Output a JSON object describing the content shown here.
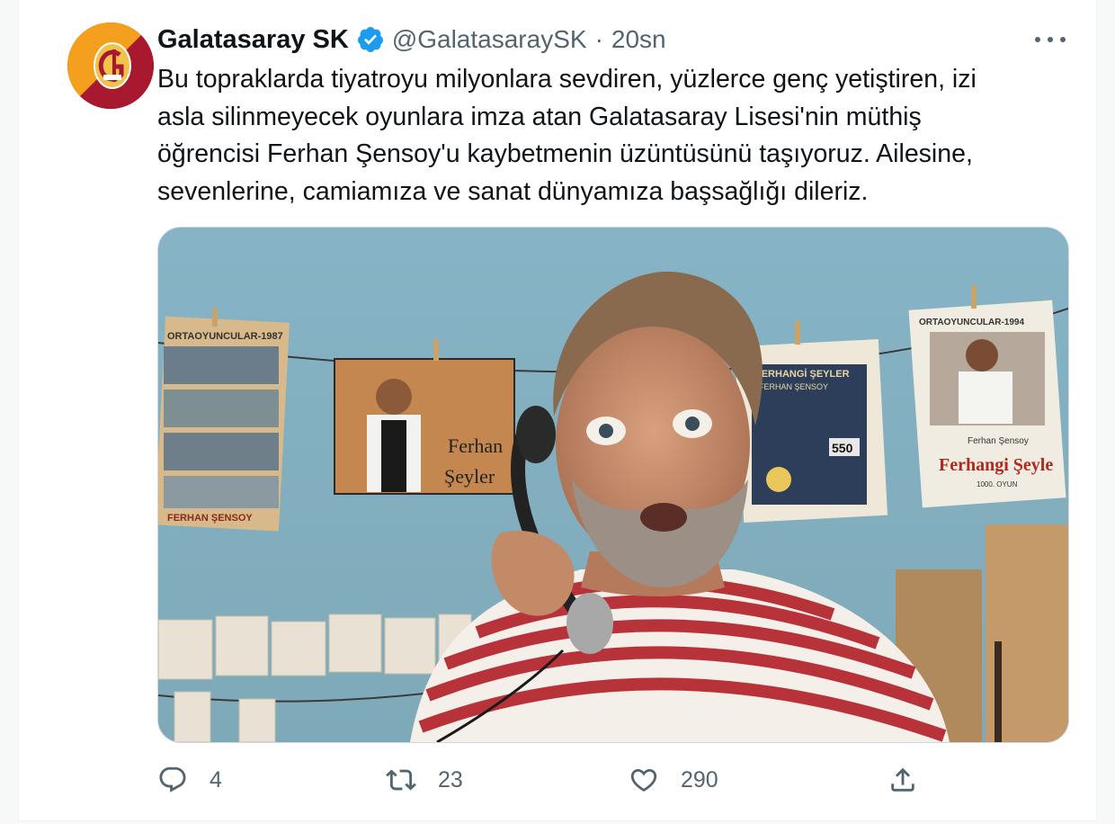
{
  "tweet": {
    "author_name": "Galatasaray SK",
    "author_handle": "@GalatasaraySK",
    "separator": "·",
    "timestamp": "20sn",
    "verified": true,
    "text_lines": [
      "Bu topraklarda tiyatroyu milyonlara sevdiren, yüzlerce genç yetiştiren, izi",
      "asla silinmeyecek oyunlara imza atan Galatasaray Lisesi'nin müthiş",
      "öğrencisi Ferhan Şensoy'u kaybetmenin üzüntüsünü taşıyoruz. Ailesine,",
      "sevenlerine, camiamıza ve sanat dünyamıza başsağlığı dileriz."
    ],
    "media": {
      "poster_left_caption": "ORTAOYUNCULAR-1987",
      "poster_left_footer": "FERHAN ŞENSOY",
      "poster_mid_text_1": "Ferhan",
      "poster_mid_text_2": "Şeyler",
      "poster_right1_title": "FERHANGİ ŞEYLER",
      "poster_right1_subtitle": "FERHAN ŞENSOY",
      "poster_right1_badge": "550",
      "poster_right2_caption": "ORTAOYUNCULAR-1994",
      "poster_right2_name": "Ferhan Şensoy",
      "poster_right2_title": "Ferhangi Şeyle",
      "poster_right2_footer": "1000. OYUN"
    },
    "actions": {
      "reply_count": "4",
      "retweet_count": "23",
      "like_count": "290"
    },
    "colors": {
      "text": "#0f1419",
      "secondary": "#536471",
      "verified": "#1d9bf0",
      "club_yellow": "#f4a01e",
      "club_red": "#a8182e"
    },
    "icons": [
      "verified-badge-icon",
      "more-icon",
      "reply-icon",
      "retweet-icon",
      "like-icon",
      "share-icon"
    ]
  }
}
